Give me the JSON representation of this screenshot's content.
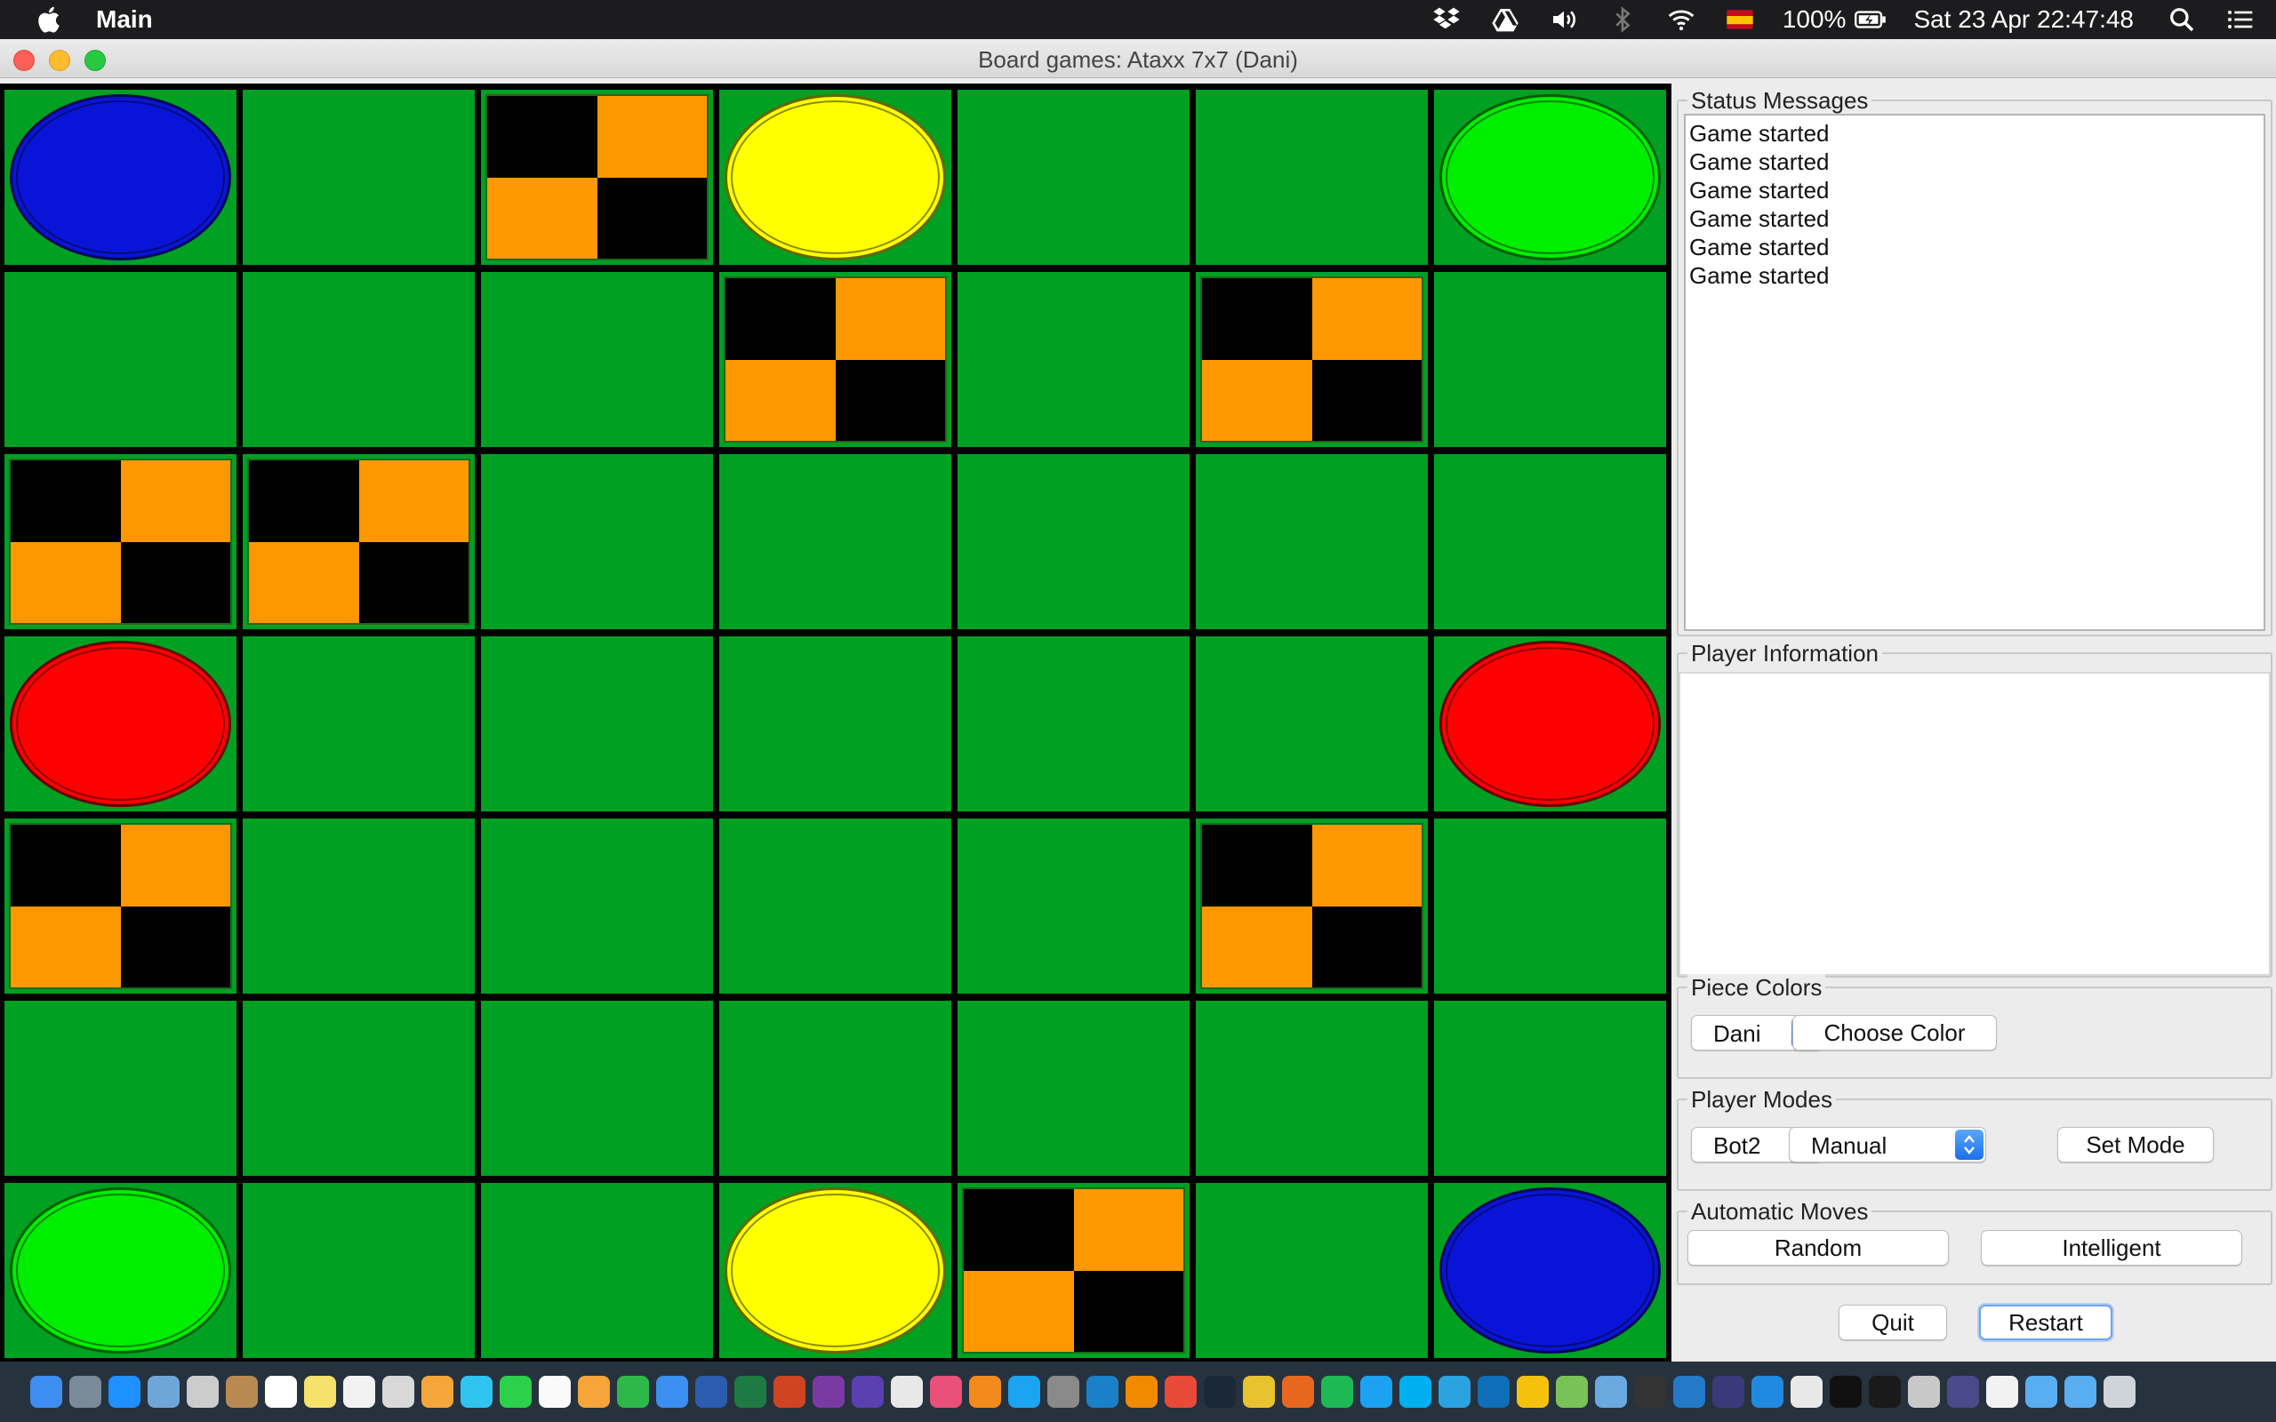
{
  "menubar": {
    "app_name": "Main",
    "battery": "100%",
    "datetime": "Sat 23 Apr  22:47:48",
    "icons": [
      "apple-icon",
      "dropbox-icon",
      "google-drive-icon",
      "volume-icon",
      "bluetooth-icon",
      "wifi-icon",
      "input-source-flag-icon",
      "battery-icon",
      "spotlight-search-icon",
      "notification-center-icon"
    ]
  },
  "window": {
    "title": "Board games: Ataxx 7x7 (Dani)"
  },
  "board": {
    "size": 7,
    "colors": {
      "cell": "#00a023",
      "blue": "#0a14d8",
      "yellow": "#ffff00",
      "green": "#00ee00",
      "red": "#ff0000",
      "obstacle_dark": "#000000",
      "obstacle_light": "#ff9800"
    },
    "rows": [
      [
        "blue",
        "",
        "obstacle",
        "yellow",
        "",
        "",
        "green"
      ],
      [
        "",
        "",
        "",
        "obstacle",
        "",
        "obstacle",
        ""
      ],
      [
        "obstacle",
        "obstacle",
        "",
        "",
        "",
        "",
        ""
      ],
      [
        "red",
        "",
        "",
        "",
        "",
        "",
        "red"
      ],
      [
        "obstacle",
        "",
        "",
        "",
        "",
        "obstacle",
        ""
      ],
      [
        "",
        "",
        "",
        "",
        "",
        "",
        ""
      ],
      [
        "green",
        "",
        "",
        "yellow",
        "obstacle",
        "",
        "blue"
      ]
    ]
  },
  "status": {
    "title": "Status Messages",
    "messages": [
      "Game started",
      "Game started",
      "Game started",
      "Game started",
      "Game started",
      "Game started"
    ]
  },
  "player_info": {
    "title": "Player Information"
  },
  "piece_colors": {
    "title": "Piece Colors",
    "player_selected": "Dani",
    "choose_color_label": "Choose Color"
  },
  "player_modes": {
    "title": "Player Modes",
    "player_selected": "Bot2",
    "mode_selected": "Manual",
    "set_mode_label": "Set Mode"
  },
  "automatic_moves": {
    "title": "Automatic Moves",
    "random_label": "Random",
    "intelligent_label": "Intelligent"
  },
  "actions": {
    "quit_label": "Quit",
    "restart_label": "Restart"
  },
  "dock": {
    "apps": [
      {
        "name": "finder",
        "color": "#3d8ef0"
      },
      {
        "name": "launchpad",
        "color": "#7a8a99"
      },
      {
        "name": "safari",
        "color": "#1e90ff"
      },
      {
        "name": "preview",
        "color": "#6fa6d8"
      },
      {
        "name": "automator",
        "color": "#cccccc"
      },
      {
        "name": "contacts",
        "color": "#b88a52"
      },
      {
        "name": "calendar",
        "color": "#ffffff"
      },
      {
        "name": "notes",
        "color": "#f5e16c"
      },
      {
        "name": "reminders",
        "color": "#f2f2f2"
      },
      {
        "name": "photo-booth",
        "color": "#d8d8d8"
      },
      {
        "name": "photos",
        "color": "#f4a63a"
      },
      {
        "name": "messages",
        "color": "#2fc3f0"
      },
      {
        "name": "facetime",
        "color": "#2bd14a"
      },
      {
        "name": "textedit",
        "color": "#fafafa"
      },
      {
        "name": "pages",
        "color": "#f7a43a"
      },
      {
        "name": "numbers",
        "color": "#2fb84a"
      },
      {
        "name": "keynote",
        "color": "#3a8ff0"
      },
      {
        "name": "word",
        "color": "#2b5caf"
      },
      {
        "name": "excel",
        "color": "#1e7a43"
      },
      {
        "name": "powerpoint",
        "color": "#d04424"
      },
      {
        "name": "onenote",
        "color": "#7a3aa4"
      },
      {
        "name": "imovie",
        "color": "#5a3fb0"
      },
      {
        "name": "prism",
        "color": "#e8e8e8"
      },
      {
        "name": "itunes",
        "color": "#e9507a"
      },
      {
        "name": "ibooks",
        "color": "#f28a1c"
      },
      {
        "name": "app-store",
        "color": "#1ca4f0"
      },
      {
        "name": "system-preferences",
        "color": "#8a8a8a"
      },
      {
        "name": "edge",
        "color": "#1a80c8"
      },
      {
        "name": "vlc",
        "color": "#f28a00"
      },
      {
        "name": "popcorn",
        "color": "#e84a3a"
      },
      {
        "name": "steam",
        "color": "#1b2838"
      },
      {
        "name": "chrome",
        "color": "#e9c232"
      },
      {
        "name": "firefox",
        "color": "#e8671f"
      },
      {
        "name": "spotify",
        "color": "#1db954"
      },
      {
        "name": "twitter",
        "color": "#1da1f2"
      },
      {
        "name": "skype",
        "color": "#00aff0"
      },
      {
        "name": "telegram",
        "color": "#2aa3e0"
      },
      {
        "name": "teamviewer",
        "color": "#0e6eb8"
      },
      {
        "name": "google-drive",
        "color": "#f4c20d"
      },
      {
        "name": "android-studio",
        "color": "#78c257"
      },
      {
        "name": "virtualbox",
        "color": "#6aa8e0"
      },
      {
        "name": "github",
        "color": "#333333"
      },
      {
        "name": "vscode",
        "color": "#2479c9"
      },
      {
        "name": "eclipse",
        "color": "#3a3a7a"
      },
      {
        "name": "xcode",
        "color": "#1f8ae0"
      },
      {
        "name": "package",
        "color": "#e8e8e8"
      },
      {
        "name": "terminal",
        "color": "#111111"
      },
      {
        "name": "activity-monitor",
        "color": "#1a1a1a"
      },
      {
        "name": "system-information",
        "color": "#c8c8c8"
      },
      {
        "name": "eclipse-2",
        "color": "#4a4a8a"
      },
      {
        "name": "java",
        "color": "#f2f2f2"
      },
      {
        "name": "folder",
        "color": "#58aef0"
      },
      {
        "name": "downloads",
        "color": "#58aef0"
      },
      {
        "name": "trash",
        "color": "#cfd4d8"
      }
    ]
  }
}
